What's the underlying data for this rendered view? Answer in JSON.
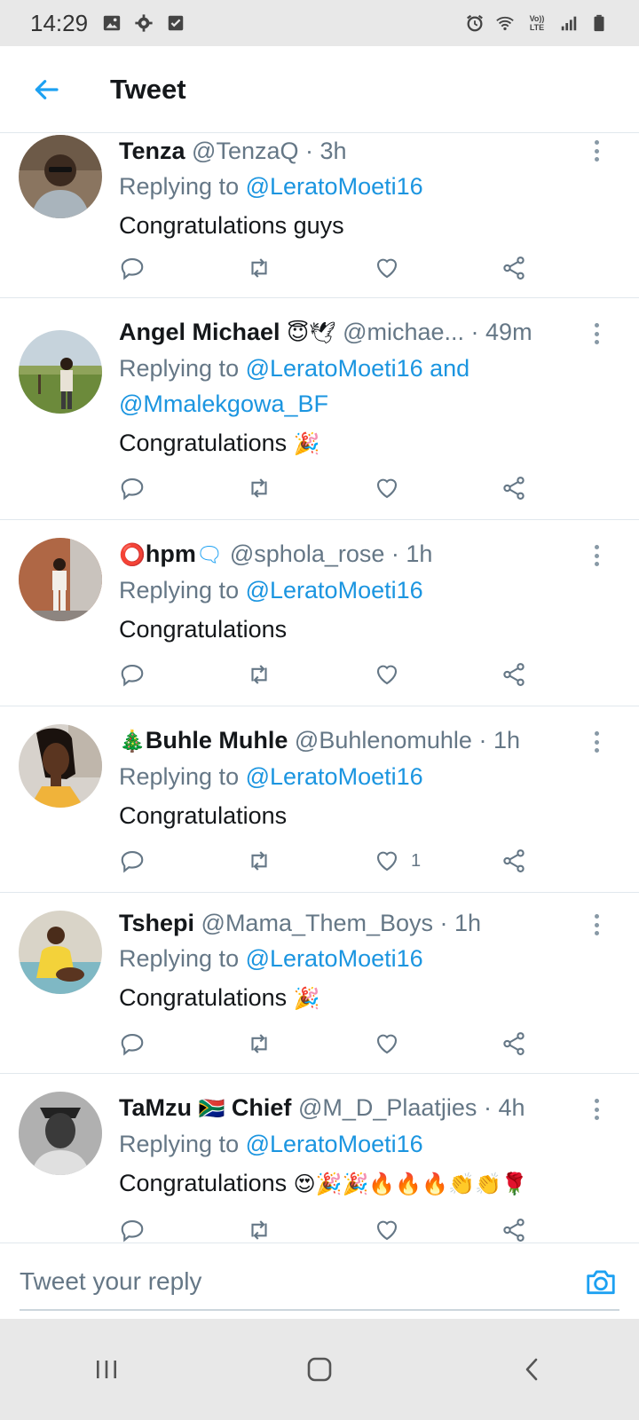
{
  "status_bar": {
    "time": "14:29",
    "left_icons": [
      "image-icon",
      "gear-icon",
      "checkbox-icon"
    ],
    "right_icons": [
      "alarm-icon",
      "wifi-icon",
      "volte-icon",
      "signal-icon",
      "battery-icon"
    ],
    "volte_label": "Vo)) LTE"
  },
  "header": {
    "back_icon": "arrow-left-icon",
    "title": "Tweet",
    "accent_color": "#1da1f2"
  },
  "replying_label": "Replying to",
  "tweets": [
    {
      "name": "Tenza",
      "name_prefix_emoji": "",
      "name_suffix_emoji": "",
      "handle": "@TenzaQ",
      "time": "· 3h",
      "mentions": [
        "@LeratoMoeti16"
      ],
      "text": "Congratulations guys",
      "emojis": "",
      "likes": ""
    },
    {
      "name": "Angel Michael",
      "name_prefix_emoji": "",
      "name_suffix_emoji": "😇🕊",
      "handle": "@michae...",
      "time": "· 49m",
      "mentions": [
        "@LeratoMoeti16 and",
        "@Mmalekgowa_BF"
      ],
      "text": "Congratulations",
      "emojis": "🎉",
      "likes": ""
    },
    {
      "name": "hpm",
      "name_prefix_emoji": "⭕",
      "name_suffix_emoji": "🗨",
      "handle": "@sphola_rose",
      "time": "· 1h",
      "mentions": [
        "@LeratoMoeti16"
      ],
      "text": "Congratulations",
      "emojis": "",
      "likes": ""
    },
    {
      "name": "Buhle Muhle",
      "name_prefix_emoji": "🎄",
      "name_suffix_emoji": "",
      "handle": "@Buhlenomuhle",
      "time": "· 1h",
      "mentions": [
        "@LeratoMoeti16"
      ],
      "text": "Congratulations",
      "emojis": "",
      "likes": "1"
    },
    {
      "name": "Tshepi",
      "name_prefix_emoji": "",
      "name_suffix_emoji": "",
      "handle": "@Mama_Them_Boys",
      "time": "· 1h",
      "mentions": [
        "@LeratoMoeti16"
      ],
      "text": "Congratulations",
      "emojis": "🎉",
      "likes": ""
    },
    {
      "name": "TaMzu",
      "name_prefix_emoji": "",
      "name_suffix_emoji": "🇿🇦",
      "name_tail": "Chief",
      "handle": "@M_D_Plaatjies",
      "time": "· 4h",
      "mentions": [
        "@LeratoMoeti16"
      ],
      "text": "Congratulations",
      "emojis": "😍🎉🎉🔥🔥🔥👏👏🌹",
      "likes": ""
    }
  ],
  "reply_bar": {
    "placeholder": "Tweet your reply",
    "camera_icon": "camera-icon"
  },
  "nav_bar": {
    "icons": [
      "recent-apps-icon",
      "home-icon",
      "back-icon"
    ]
  }
}
